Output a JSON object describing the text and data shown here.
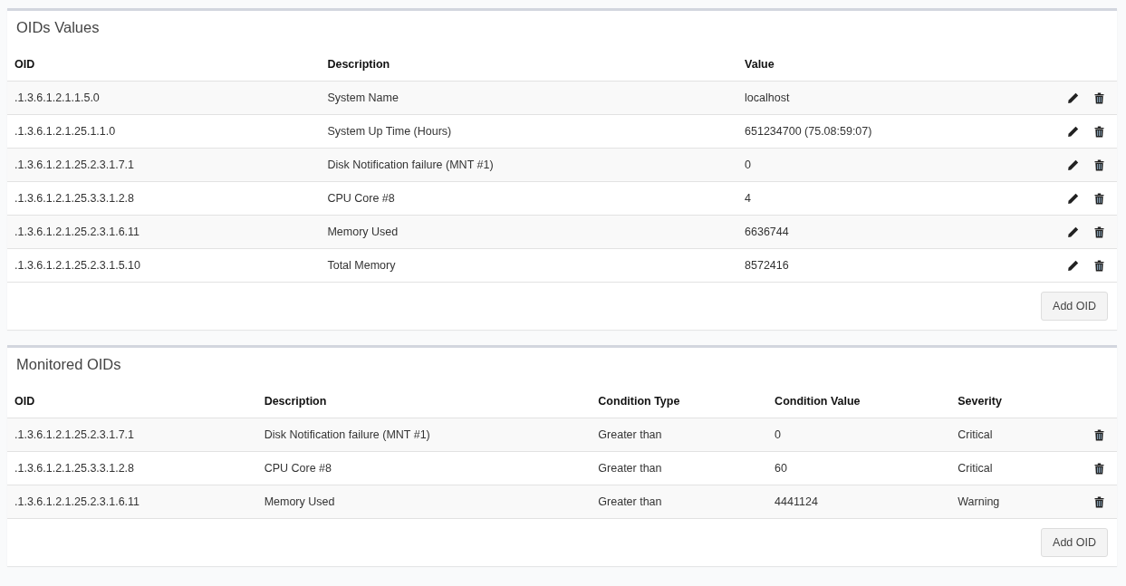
{
  "sections": [
    {
      "title": "OIDs Values",
      "columns": [
        "OID",
        "Description",
        "Value"
      ],
      "row_actions": [
        {
          "kind": "edit"
        },
        {
          "kind": "delete"
        }
      ],
      "rows": [
        [
          ".1.3.6.1.2.1.1.5.0",
          "System Name",
          "localhost"
        ],
        [
          ".1.3.6.1.2.1.25.1.1.0",
          "System Up Time (Hours)",
          "651234700 (75.08:59:07)"
        ],
        [
          ".1.3.6.1.2.1.25.2.3.1.7.1",
          "Disk Notification failure (MNT #1)",
          "0"
        ],
        [
          ".1.3.6.1.2.1.25.3.3.1.2.8",
          "CPU Core #8",
          "4"
        ],
        [
          ".1.3.6.1.2.1.25.2.3.1.6.11",
          "Memory Used",
          "6636744"
        ],
        [
          ".1.3.6.1.2.1.25.2.3.1.5.10",
          "Total Memory",
          "8572416"
        ]
      ],
      "button": "Add OID"
    },
    {
      "title": "Monitored OIDs",
      "columns": [
        "OID",
        "Description",
        "Condition Type",
        "Condition Value",
        "Severity"
      ],
      "row_actions": [
        {
          "kind": "delete"
        }
      ],
      "rows": [
        [
          ".1.3.6.1.2.1.25.2.3.1.7.1",
          "Disk Notification failure (MNT #1)",
          "Greater than",
          "0",
          "Critical"
        ],
        [
          ".1.3.6.1.2.1.25.3.3.1.2.8",
          "CPU Core #8",
          "Greater than",
          "60",
          "Critical"
        ],
        [
          ".1.3.6.1.2.1.25.2.3.1.6.11",
          "Memory Used",
          "Greater than",
          "4441124",
          "Warning"
        ]
      ],
      "button": "Add OID"
    }
  ]
}
